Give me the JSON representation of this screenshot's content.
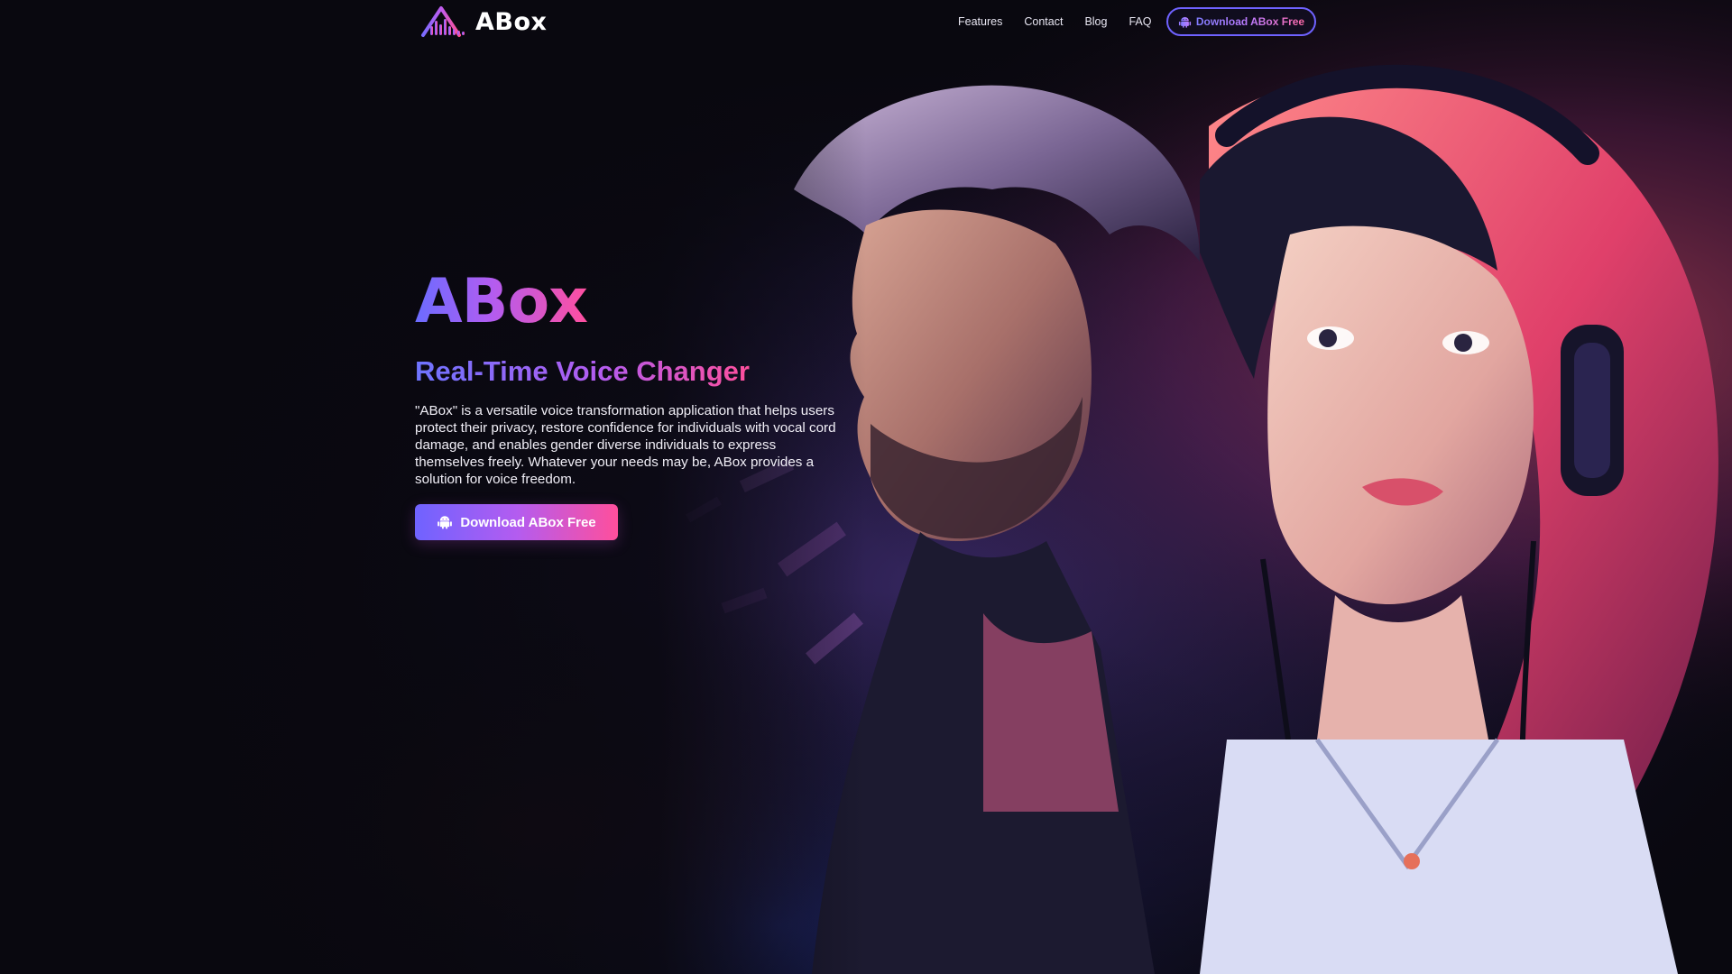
{
  "brand": {
    "name": "ABox",
    "logo_icon": "waveform-triangle-icon"
  },
  "nav": {
    "links": [
      {
        "label": "Features"
      },
      {
        "label": "Contact"
      },
      {
        "label": "Blog"
      },
      {
        "label": "FAQ"
      }
    ],
    "download_label": "Download ABox Free",
    "download_icon": "android-icon"
  },
  "hero": {
    "title": "ABox",
    "subtitle": "Real-Time Voice Changer",
    "description": "\"ABox\" is a versatile voice transformation application that helps users protect their privacy, restore confidence for individuals with vocal cord damage, and enables gender diverse individuals to express themselves freely. Whatever your needs may be, ABox provides a solution for voice freedom.",
    "download_label": "Download ABox Free",
    "download_icon": "android-icon",
    "artwork": "illustrated-man-and-woman-with-headphones"
  },
  "colors": {
    "background": "#09080f",
    "accent_blue": "#6b6cff",
    "accent_purple": "#b35cf0",
    "accent_pink": "#ff4fa0"
  }
}
